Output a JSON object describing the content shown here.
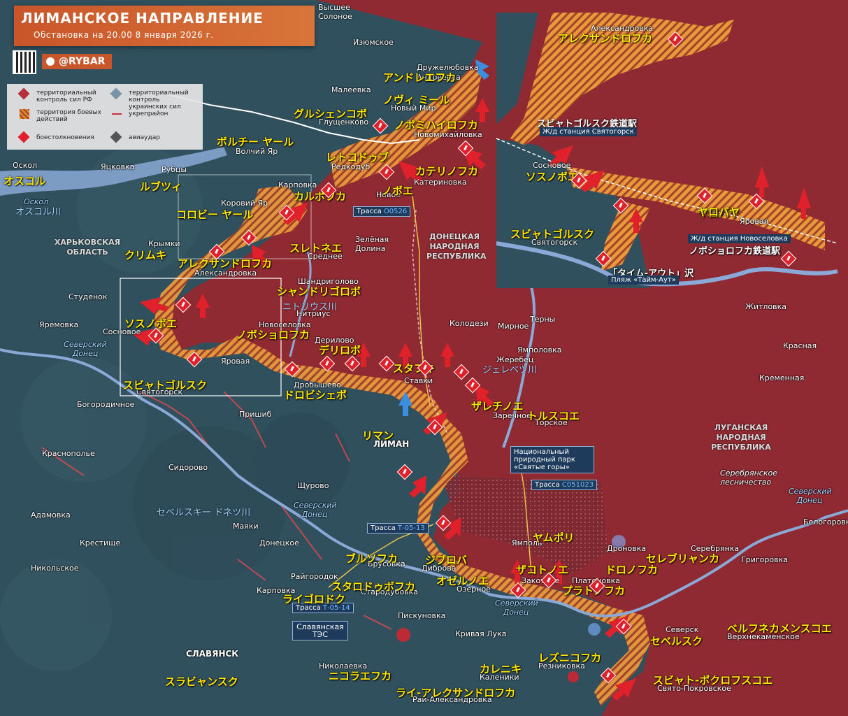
{
  "header": {
    "title": "ЛИМАНСКОЕ НАПРАВЛЕНИЕ",
    "subtitle": "Обстановка на 20.00 8 января 2026 г.",
    "brand": "@RYBAR"
  },
  "legend": {
    "items": [
      {
        "label": "территориальный контроль сил РФ",
        "color": "#b5303a"
      },
      {
        "label": "территориальный контроль украинских сил",
        "color": "#7a93a6"
      },
      {
        "label": "территория боевых действий",
        "color": "#e08a2a"
      },
      {
        "label": "укрепрайон",
        "color": "#d0303a"
      },
      {
        "label": "боестолкновения",
        "color": "#e0202a"
      },
      {
        "label": "авиаудар",
        "color": "#555555"
      }
    ]
  },
  "regions": {
    "kharkiv": "ХАРЬКОВСКАЯ ОБЛАСТЬ",
    "donetsk": "ДОНЕЦКАЯ НАРОДНАЯ РЕСПУБЛИКА",
    "luhansk": "ЛУГАНСКАЯ НАРОДНАЯ РЕСПУБЛИКА"
  },
  "roads": {
    "o0526": {
      "prefix": "Трасса",
      "code": "О0526"
    },
    "c051023": {
      "prefix": "Трасса",
      "code": "С051023"
    },
    "t0513": {
      "prefix": "Трасса",
      "code": "Т-05-13"
    },
    "t0514": {
      "prefix": "Трасса",
      "code": "Т-05-14"
    }
  },
  "park": "Национальный природный парк «Святые горы»",
  "forest": "Серебрянское лесничество",
  "tes": "Славянская ТЭС",
  "places_ru": [
    {
      "k": "vysshee",
      "t": "Высшее Солоное"
    },
    {
      "k": "izyumskoe",
      "t": "Изюмское"
    },
    {
      "k": "druzhel",
      "t": "Дружелюбовка"
    },
    {
      "k": "andreevka",
      "t": "Андреевка"
    },
    {
      "k": "maleevka",
      "t": "Малеевка"
    },
    {
      "k": "novymir",
      "t": "Новый Мир"
    },
    {
      "k": "glusch",
      "t": "Глущенково"
    },
    {
      "k": "novomikh",
      "t": "Новомихайловка"
    },
    {
      "k": "volchiy",
      "t": "Волчий Яр"
    },
    {
      "k": "oskol",
      "t": "Оскол"
    },
    {
      "k": "yatskovka",
      "t": "Яцковка"
    },
    {
      "k": "rubtsy",
      "t": "Рубцы"
    },
    {
      "k": "redkodub",
      "t": "Редкодуб"
    },
    {
      "k": "katerin",
      "t": "Катериновка"
    },
    {
      "k": "karpovka",
      "t": "Карповка"
    },
    {
      "k": "novoe",
      "t": "Новое"
    },
    {
      "k": "korovy",
      "t": "Коровий Яр"
    },
    {
      "k": "zelenaya",
      "t": "Зелёная Долина"
    },
    {
      "k": "srednee",
      "t": "Среднее"
    },
    {
      "k": "krymki",
      "t": "Крымки"
    },
    {
      "k": "aleks",
      "t": "Александровка"
    },
    {
      "k": "shandr",
      "t": "Шандриголово"
    },
    {
      "k": "nitrius",
      "t": "Нитриус"
    },
    {
      "k": "studenok",
      "t": "Студенок"
    },
    {
      "k": "yaremovka",
      "t": "Яремовка"
    },
    {
      "k": "sosnovoe",
      "t": "Сосновое"
    },
    {
      "k": "novoselovka",
      "t": "Новоселовка"
    },
    {
      "k": "derilovo",
      "t": "Дерилово"
    },
    {
      "k": "kolodezi",
      "t": "Колодези"
    },
    {
      "k": "mirnoe",
      "t": "Мирное"
    },
    {
      "k": "terny",
      "t": "Терны"
    },
    {
      "k": "zhitlovka",
      "t": "Житловка"
    },
    {
      "k": "yampolovka",
      "t": "Ямполовка"
    },
    {
      "k": "zherebets",
      "t": "Жеребец"
    },
    {
      "k": "yarovaya",
      "t": "Яровая"
    },
    {
      "k": "drobyshevo",
      "t": "Дробышево"
    },
    {
      "k": "stavki",
      "t": "Ставки"
    },
    {
      "k": "svyatogorsk",
      "t": "Святогорск"
    },
    {
      "k": "kremennaya",
      "t": "Кременная"
    },
    {
      "k": "bogorod",
      "t": "Богородичное"
    },
    {
      "k": "prishib",
      "t": "Пришиб"
    },
    {
      "k": "zarechnoe",
      "t": "Заречное"
    },
    {
      "k": "torskoe",
      "t": "Торское"
    },
    {
      "k": "liman",
      "t": "ЛИМАН"
    },
    {
      "k": "krasnopol",
      "t": "Краснополье"
    },
    {
      "k": "sidorovo",
      "t": "Сидорово"
    },
    {
      "k": "schurovo",
      "t": "Щурово"
    },
    {
      "k": "adamovka",
      "t": "Адамовка"
    },
    {
      "k": "mayaki",
      "t": "Маяки"
    },
    {
      "k": "yampol",
      "t": "Ямполь"
    },
    {
      "k": "kresti",
      "t": "Крестище"
    },
    {
      "k": "donetskoe",
      "t": "Донецкое"
    },
    {
      "k": "nikolskoe",
      "t": "Никольское"
    },
    {
      "k": "brusovka",
      "t": "Брусовка"
    },
    {
      "k": "dibrova",
      "t": "Диброва"
    },
    {
      "k": "dronovka",
      "t": "Дроновка"
    },
    {
      "k": "serebryanka",
      "t": "Серебрянка"
    },
    {
      "k": "grigorovka",
      "t": "Григоровка"
    },
    {
      "k": "belogorovka",
      "t": "Белогоровка"
    },
    {
      "k": "raygorodok",
      "t": "Райгородок"
    },
    {
      "k": "starodubovka",
      "t": "Стародубовка"
    },
    {
      "k": "karpovka2",
      "t": "Карповка"
    },
    {
      "k": "zakotnoe",
      "t": "Закотное"
    },
    {
      "k": "platonovka",
      "t": "Платоновка"
    },
    {
      "k": "ozernoe",
      "t": "Озерное"
    },
    {
      "k": "piskunovka",
      "t": "Пискуновка"
    },
    {
      "k": "seversk",
      "t": "Северск"
    },
    {
      "k": "verkhnekam",
      "t": "Верхнекаменское"
    },
    {
      "k": "krivayaluka",
      "t": "Кривая Лука"
    },
    {
      "k": "rezkinovka",
      "t": "Резниковка"
    },
    {
      "k": "nikolaevka",
      "t": "Николаевка"
    },
    {
      "k": "kaleniki",
      "t": "Каленики"
    },
    {
      "k": "svyatopokr",
      "t": "Свято-Покровское"
    },
    {
      "k": "slavyansk",
      "t": "СЛАВЯНСК"
    },
    {
      "k": "rayaleks",
      "t": "Рай-Александровка"
    },
    {
      "k": "krasnaya",
      "t": "Красная"
    }
  ],
  "places_jp": [
    {
      "k": "andre",
      "t": "アンドレエフカ"
    },
    {
      "k": "novmir",
      "t": "ノヴィ ミール"
    },
    {
      "k": "glushc",
      "t": "グルシェンコボ"
    },
    {
      "k": "novomi",
      "t": "ノボミハイロフカ"
    },
    {
      "k": "volchi",
      "t": "ボルチー ヤール"
    },
    {
      "k": "redko",
      "t": "レトコドゥブ"
    },
    {
      "k": "oskolj",
      "t": "オスコル"
    },
    {
      "k": "rubtsj",
      "t": "ルブツィ"
    },
    {
      "k": "katerj",
      "t": "カテリノフカ"
    },
    {
      "k": "karpj",
      "t": "カルポフカ"
    },
    {
      "k": "novoej",
      "t": "ノボエ"
    },
    {
      "k": "korovj",
      "t": "コロビー ヤール"
    },
    {
      "k": "krymj",
      "t": "クリムキ"
    },
    {
      "k": "srednj",
      "t": "スレトネエ"
    },
    {
      "k": "aleksj",
      "t": "アレクサンドロフカ"
    },
    {
      "k": "shandj",
      "t": "シャンドリゴロボ"
    },
    {
      "k": "sosnj",
      "t": "ソスノボエ"
    },
    {
      "k": "novosj",
      "t": "ノボショロフカ"
    },
    {
      "k": "derilj",
      "t": "デリロボ"
    },
    {
      "k": "stavj",
      "t": "スタフキ"
    },
    {
      "k": "yarovj",
      "t": "ヤロバヤ"
    },
    {
      "k": "svyatj",
      "t": "スビャトゴルスク"
    },
    {
      "k": "drobj",
      "t": "ドロビシェボ"
    },
    {
      "k": "zarechj",
      "t": "ザレチノエ"
    },
    {
      "k": "torskj",
      "t": "トルスコエ"
    },
    {
      "k": "limanj",
      "t": "リマン"
    },
    {
      "k": "yampj",
      "t": "ヤムポリ"
    },
    {
      "k": "brusj",
      "t": "ブルソフカ"
    },
    {
      "k": "dibj",
      "t": "ジブロバ"
    },
    {
      "k": "zakotj",
      "t": "ザコトノエ"
    },
    {
      "k": "dronj",
      "t": "ドロノフカ"
    },
    {
      "k": "serebj",
      "t": "セレブリャンカ"
    },
    {
      "k": "starj",
      "t": "スタロドゥボフカ"
    },
    {
      "k": "ozerj",
      "t": "オゼルノエ"
    },
    {
      "k": "platj",
      "t": "プラトノフカ"
    },
    {
      "k": "raygj",
      "t": "ライゴロドク"
    },
    {
      "k": "verkhj",
      "t": "ベルフネカメンスコエ"
    },
    {
      "k": "severj",
      "t": "セベルスク"
    },
    {
      "k": "kalenj",
      "t": "カレニキ"
    },
    {
      "k": "rezj",
      "t": "レズニコフカ"
    },
    {
      "k": "nikolj",
      "t": "ニコラエフカ"
    },
    {
      "k": "slavj",
      "t": "スラビャンスク"
    },
    {
      "k": "svpokj",
      "t": "スビャト-ポクロフスコエ"
    },
    {
      "k": "rayaj",
      "t": "ライ-アレクサンドロフカ"
    }
  ],
  "rivers_jp": {
    "oskol_river": "オスコル川",
    "nitrius_river": "ニトリウス川",
    "zherebets_river": "ジェレベツ川",
    "seversky_donets": "セベルスキー ドネツ川"
  },
  "rivers_ru": {
    "oskol": "Оскол",
    "seversky1": "Северский Донец",
    "seversky2": "Северский Донец",
    "seversky3": "Северский Донец",
    "seversky4": "Северский Донец"
  },
  "inset": {
    "aleks_ru": "Александровка",
    "aleks_jp": "アレクサンドロフカ",
    "station1_jp": "スビャトゴルスク鉄道駅",
    "station1_ru": "Ж/д станция Святогорск",
    "sosnovoe_ru": "Сосновое",
    "sosnovoe_jp": "ソスノボエ",
    "yarovaya_jp": "ヤロバヤ",
    "yarovaya_ru": "Яровая",
    "svyat_jp": "スビャトゴルスク",
    "svyat_ru": "Святогорск",
    "station2_ru": "Ж/д станция Новоселовка",
    "station2_jp": "ノボショロフカ鉄道駅",
    "beach_jp": "「タイム-アウト」沢",
    "beach_ru": "Пляж «Тайм-Аут»"
  },
  "colors": {
    "ru_control": "#8f2a33",
    "ua_control": "#34505f",
    "combat": "#e39a3a",
    "fortline": "#e0484f",
    "title_bg": "#d06330"
  }
}
